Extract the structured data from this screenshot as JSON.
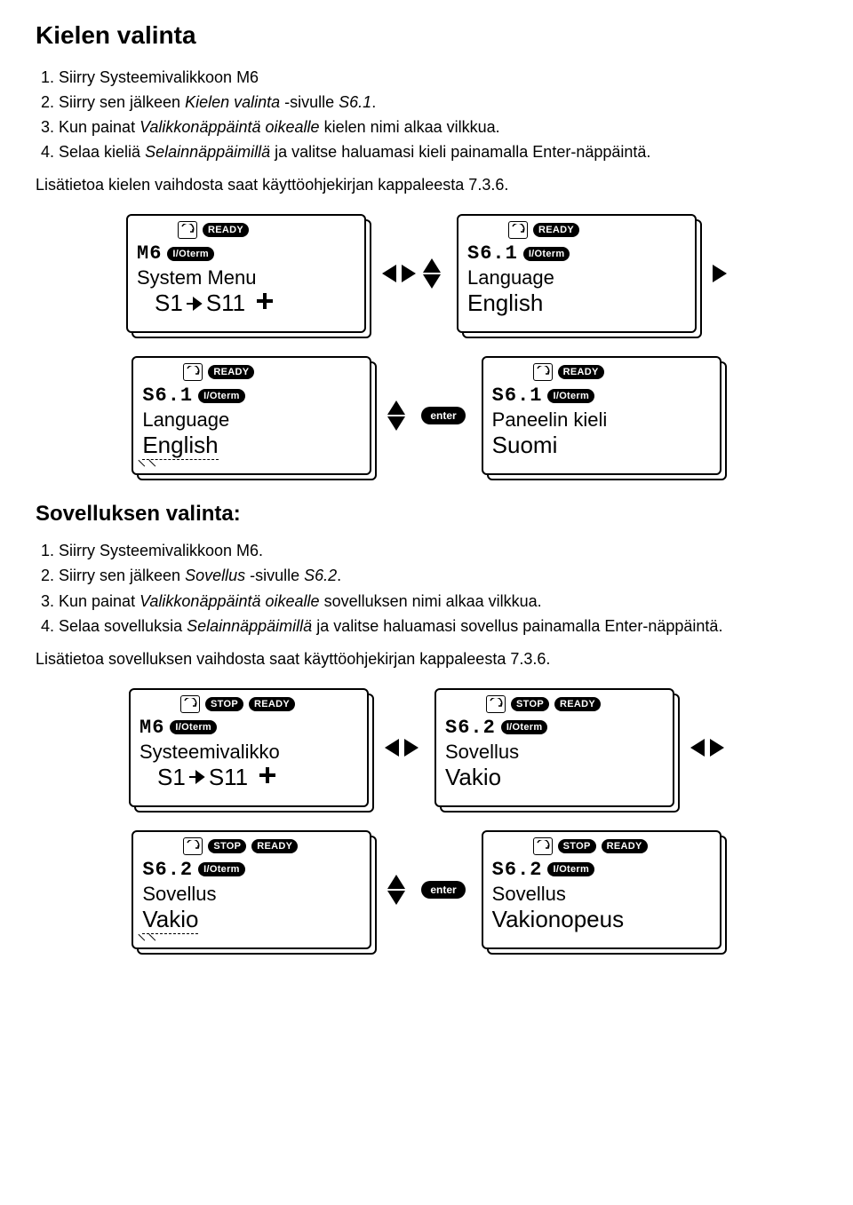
{
  "section1": {
    "title": "Kielen valinta",
    "steps": [
      {
        "text": "Siirry Systeemivalikkoon ",
        "code": "M6"
      },
      {
        "text": "Siirry sen jälkeen ",
        "emph": "Kielen valinta",
        "text2": " -sivulle ",
        "code": "S6.1",
        "tail": "."
      },
      {
        "text": "Kun painat ",
        "emph": "Valikkonäppäintä oikealle",
        "text2": " kielen nimi alkaa vilkkua."
      },
      {
        "text": "Selaa kieliä ",
        "emph": "Selainnäppäimillä",
        "text2": " ja valitse haluamasi kieli painamalla Enter-näppäintä."
      }
    ],
    "info": "Lisätietoa kielen vaihdosta saat käyttöohjekirjan kappaleesta 7.3.6."
  },
  "section2": {
    "title": "Sovelluksen valinta:",
    "steps": [
      {
        "text": "Siirry Systeemivalikkoon M6."
      },
      {
        "text": "Siirry sen jälkeen ",
        "emph": "Sovellus",
        "text2": " -sivulle ",
        "code": "S6.2",
        "tail": "."
      },
      {
        "text": "Kun painat ",
        "emph": "Valikkonäppäintä oikealle",
        "text2": " sovelluksen nimi alkaa vilkkua."
      },
      {
        "text": "Selaa sovelluksia ",
        "emph": "Selainnäppäimillä",
        "text2": " ja valitse haluamasi sovellus painamalla Enter-näppäintä."
      }
    ],
    "info": "Lisätietoa sovelluksen vaihdosta saat käyttöohjekirjan kappaleesta 7.3.6."
  },
  "labels": {
    "ready": "READY",
    "stop": "STOP",
    "ioterm": "I/Oterm",
    "enter": "enter"
  },
  "panels": {
    "p1": {
      "id": "M6",
      "line1": "System Menu",
      "s1": "S1",
      "s2": "S11"
    },
    "p2": {
      "id": "S6.1",
      "line1": "Language",
      "line2": "English"
    },
    "p3": {
      "id": "S6.1",
      "line1": "Language",
      "line2": "English"
    },
    "p4": {
      "id": "S6.1",
      "line1": "Paneelin kieli",
      "line2": "Suomi"
    },
    "p5": {
      "id": "M6",
      "line1": "Systeemivalikko",
      "s1": "S1",
      "s2": "S11"
    },
    "p6": {
      "id": "S6.2",
      "line1": "Sovellus",
      "line2": "Vakio"
    },
    "p7": {
      "id": "S6.2",
      "line1": "Sovellus",
      "line2": "Vakio"
    },
    "p8": {
      "id": "S6.2",
      "line1": "Sovellus",
      "line2": "Vakionopeus"
    }
  }
}
